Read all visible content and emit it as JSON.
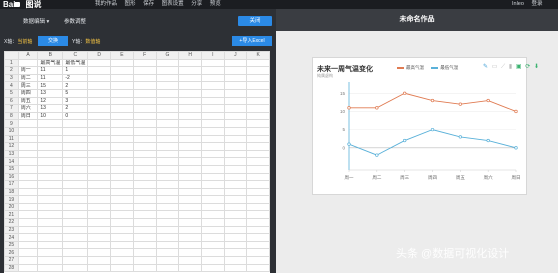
{
  "topbar": {
    "logo": "Bai",
    "logo_suffix": "图说",
    "nav": [
      "我的作品",
      "图形",
      "保存",
      "图表设置",
      "分享",
      "预览"
    ],
    "user": [
      "Inleo",
      "登录"
    ]
  },
  "left_toolbar": {
    "menu_label": "数据编辑 ▾",
    "menu2_label": "参数调整",
    "close_label": "关闭",
    "x_axis_prefix": "X轴：",
    "x_axis_value": "当前轴",
    "swap_label": "交换",
    "y_axis_prefix": "Y轴：",
    "y_axis_value": "数值轴",
    "import_label": "+导入Excel"
  },
  "sheet": {
    "columns": [
      "",
      "A",
      "B",
      "C",
      "D",
      "E",
      "F",
      "G",
      "H",
      "I",
      "J",
      "K"
    ],
    "rows": [
      [
        "",
        "最高气温",
        "最低气温"
      ],
      [
        "周一",
        "11",
        "1"
      ],
      [
        "周二",
        "11",
        "-2"
      ],
      [
        "周三",
        "15",
        "2"
      ],
      [
        "周四",
        "13",
        "5"
      ],
      [
        "周五",
        "12",
        "3"
      ],
      [
        "周六",
        "13",
        "2"
      ],
      [
        "周日",
        "10",
        "0"
      ]
    ],
    "total_rows": 28
  },
  "right": {
    "title": "未命名作品"
  },
  "chart_data": {
    "type": "line",
    "title": "未来一周气温变化",
    "subtitle": "纯属虚构",
    "categories": [
      "周一",
      "周二",
      "周三",
      "周四",
      "周五",
      "周六",
      "周日"
    ],
    "series": [
      {
        "name": "最高气温",
        "values": [
          11,
          11,
          15,
          13,
          12,
          13,
          10
        ],
        "color": "#e07b52"
      },
      {
        "name": "最低气温",
        "values": [
          1,
          -2,
          2,
          5,
          3,
          2,
          0
        ],
        "color": "#5ab1d9"
      }
    ],
    "y_ticks": [
      15,
      10,
      5,
      0
    ],
    "ylim": [
      -5,
      17
    ]
  },
  "tool_icons": [
    "edit-icon",
    "refresh-icon",
    "save-image-icon"
  ],
  "watermark": "头条 @数据可视化设计"
}
